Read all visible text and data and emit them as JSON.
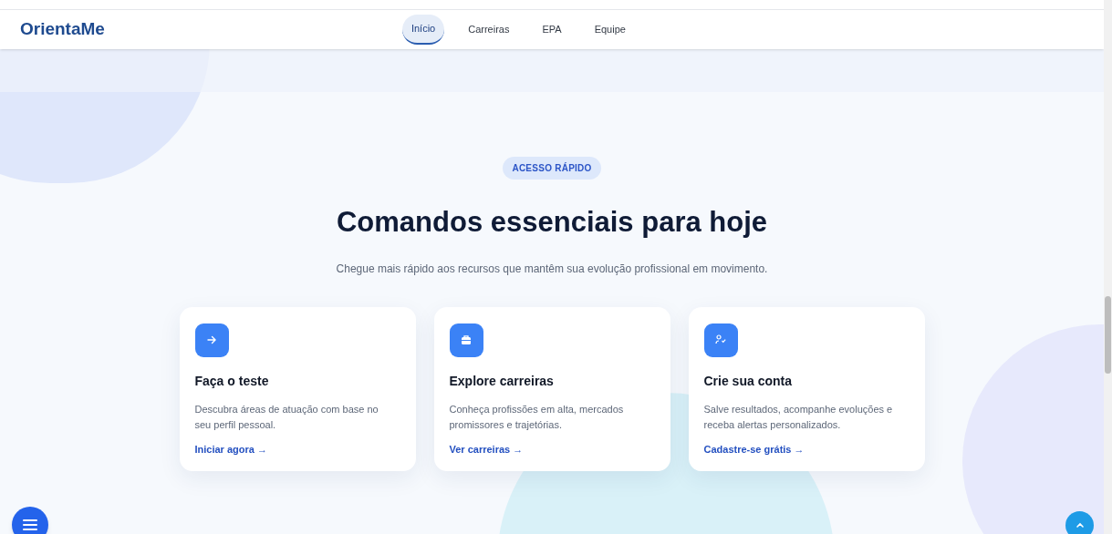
{
  "brand": "OrientaMe",
  "nav": [
    {
      "label": "Início",
      "selected": true
    },
    {
      "label": "Carreiras",
      "selected": false
    },
    {
      "label": "EPA",
      "selected": false
    },
    {
      "label": "Equipe",
      "selected": false
    }
  ],
  "badge": "ACESSO RÁPIDO",
  "heading": "Comandos essenciais para hoje",
  "subtitle": "Chegue mais rápido aos recursos que mantêm sua evolução profissional em movimento.",
  "cards": [
    {
      "kind": "arrow",
      "title": "Faça o teste",
      "description": "Descubra áreas de atuação com base no seu perfil pessoal.",
      "link": "Iniciar agora →"
    },
    {
      "kind": "briefcase",
      "title": "Explore carreiras",
      "description": "Conheça profissões em alta, mercados promissores e trajetórias.",
      "link": "Ver carreiras →"
    },
    {
      "kind": "user-check",
      "title": "Crie sua conta",
      "description": "Salve resultados, acompanhe evoluções e receba alertas personalizados.",
      "link": "Cadastre-se grátis →"
    }
  ]
}
